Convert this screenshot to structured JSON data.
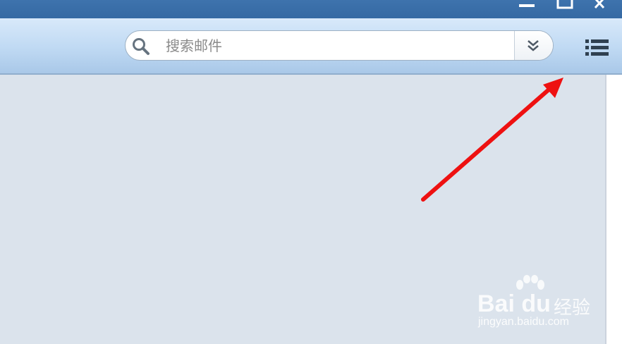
{
  "window": {
    "controls": [
      "minimize-icon",
      "maximize-icon",
      "close-icon"
    ]
  },
  "toolbar": {
    "search": {
      "placeholder": "搜索邮件",
      "icon": "search-icon",
      "dropdown_icon": "double-chevron-down-icon"
    },
    "menu_icon": "list-menu-icon"
  },
  "annotation": {
    "arrow_color": "#ee1111"
  },
  "watermark": {
    "brand": "Bai du",
    "product": "经验",
    "url": "jingyan.baidu.com"
  },
  "colors": {
    "titlebar": "#3a6ea8",
    "toolbar": "#c4dcf4",
    "content_bg": "#dbe3ec"
  }
}
